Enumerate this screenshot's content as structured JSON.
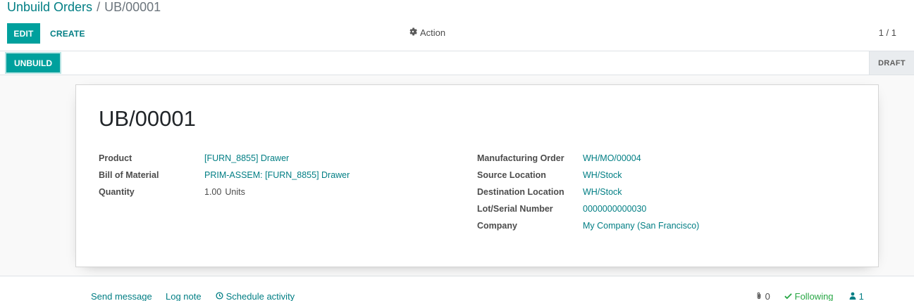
{
  "breadcrumb": {
    "parent": "Unbuild Orders",
    "separator": "/",
    "current": "UB/00001"
  },
  "toolbar": {
    "edit_label": "EDIT",
    "create_label": "CREATE",
    "action_label": "Action",
    "pager": "1 / 1"
  },
  "statusbar": {
    "unbuild_label": "UNBUILD",
    "status": "DRAFT"
  },
  "record": {
    "title": "UB/00001",
    "left_fields": [
      {
        "label": "Product",
        "value": "[FURN_8855] Drawer"
      },
      {
        "label": "Bill of Material",
        "value": "PRIM-ASSEM: [FURN_8855] Drawer"
      },
      {
        "label": "Quantity",
        "value": "1.00",
        "unit": "Units"
      }
    ],
    "right_fields": [
      {
        "label": "Manufacturing Order",
        "value": "WH/MO/00004"
      },
      {
        "label": "Source Location",
        "value": "WH/Stock"
      },
      {
        "label": "Destination Location",
        "value": "WH/Stock"
      },
      {
        "label": "Lot/Serial Number",
        "value": "0000000000030"
      },
      {
        "label": "Company",
        "value": "My Company (San Francisco)"
      }
    ]
  },
  "chatter": {
    "send_message": "Send message",
    "log_note": "Log note",
    "schedule_activity": "Schedule activity",
    "attachments_count": "0",
    "following_label": "Following",
    "followers_count": "1"
  },
  "colors": {
    "accent": "#00a09d",
    "link": "#017e84",
    "following": "#28a745"
  },
  "icons": {
    "action": "gear-icon",
    "schedule": "clock-icon",
    "attachments": "paperclip-icon",
    "following": "check-icon",
    "followers": "user-icon"
  }
}
